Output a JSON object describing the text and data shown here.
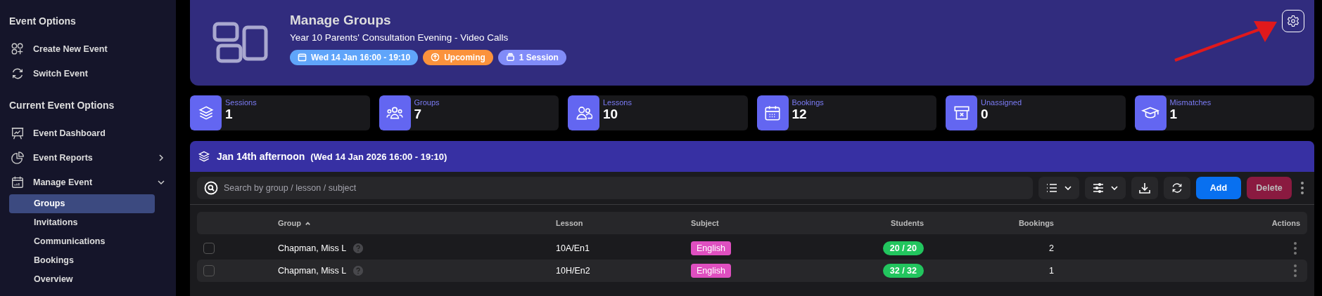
{
  "sidebar": {
    "sections": [
      {
        "heading": "Event Options",
        "items": [
          {
            "kind": "link",
            "label": "Create New Event"
          },
          {
            "kind": "link",
            "label": "Switch Event"
          }
        ]
      },
      {
        "heading": "Current Event Options",
        "items": [
          {
            "kind": "link",
            "label": "Event Dashboard"
          },
          {
            "kind": "expandable",
            "label": "Event Reports",
            "expanded": false
          },
          {
            "kind": "expandable",
            "label": "Manage Event",
            "expanded": true,
            "children": [
              {
                "label": "Groups",
                "selected": true
              },
              {
                "label": "Invitations",
                "selected": false
              },
              {
                "label": "Communications",
                "selected": false
              },
              {
                "label": "Bookings",
                "selected": false
              },
              {
                "label": "Overview",
                "selected": false
              }
            ]
          }
        ]
      }
    ]
  },
  "header": {
    "title": "Manage Groups",
    "subtitle": "Year 10 Parents' Consultation Evening - Video Calls",
    "badges": [
      {
        "label": "Wed 14 Jan 16:00 - 19:10",
        "color": "#60a5fa"
      },
      {
        "label": "Upcoming",
        "color": "#fb923c"
      },
      {
        "label": "1 Session",
        "color": "#818cf8"
      }
    ]
  },
  "stats": [
    {
      "label": "Sessions",
      "value": "1"
    },
    {
      "label": "Groups",
      "value": "7"
    },
    {
      "label": "Lessons",
      "value": "10"
    },
    {
      "label": "Bookings",
      "value": "12"
    },
    {
      "label": "Unassigned",
      "value": "0"
    },
    {
      "label": "Mismatches",
      "value": "1"
    }
  ],
  "session": {
    "title": "Jan 14th afternoon",
    "subtitle": "(Wed 14 Jan 2026 16:00 - 19:10)",
    "search": {
      "placeholder": "Search by group / lesson / subject"
    },
    "buttons": [
      {
        "label": "Add",
        "disabled": false
      },
      {
        "label": "Delete",
        "disabled": true
      }
    ]
  },
  "table": {
    "columns": [
      {
        "label": "Group",
        "sorted": true
      },
      {
        "label": "Lesson",
        "sorted": false
      },
      {
        "label": "Subject",
        "sorted": false
      },
      {
        "label": "Students",
        "sorted": false
      },
      {
        "label": "Bookings",
        "sorted": false
      },
      {
        "label": "Actions",
        "sorted": false
      }
    ],
    "rows": [
      {
        "checked": false,
        "group": "Chapman, Miss L",
        "lesson": "10A/En1",
        "subject": "English",
        "students": "20 / 20",
        "bookings": "2"
      },
      {
        "checked": false,
        "group": "Chapman, Miss L",
        "lesson": "10H/En2",
        "subject": "English",
        "students": "32 / 32",
        "bookings": "1"
      }
    ]
  }
}
